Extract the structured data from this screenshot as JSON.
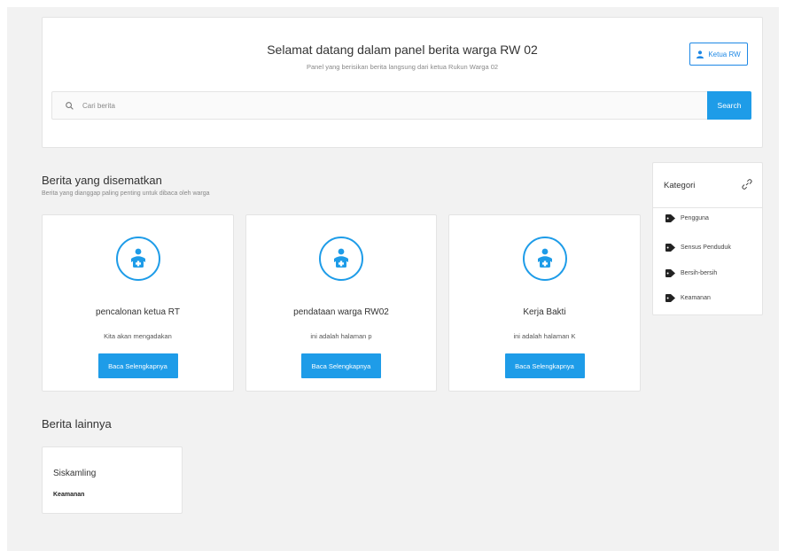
{
  "header": {
    "title": "Selamat datang dalam panel berita warga RW 02",
    "subtitle": "Panel yang berisikan berita langsung dari ketua Rukun Warga 02",
    "user_button": "Ketua RW",
    "search_placeholder": "Cari berita",
    "search_button": "Search"
  },
  "pinned": {
    "title": "Berita yang disematkan",
    "subtitle": "Berita yang dianggap paling penting untuk dibaca oleh warga",
    "items": [
      {
        "title": "pencalonan ketua RT",
        "excerpt": "Kita akan mengadakan",
        "button": "Baca Selengkapnya"
      },
      {
        "title": "pendataan warga RW02",
        "excerpt": "ini adalah halaman p",
        "button": "Baca Selengkapnya"
      },
      {
        "title": "Kerja Bakti",
        "excerpt": "ini adalah halaman K",
        "button": "Baca Selengkapnya"
      }
    ]
  },
  "kategori": {
    "title": "Kategori",
    "items": [
      "Pengguna",
      "Sensus Penduduk",
      "Bersih-bersih",
      "Keamanan"
    ]
  },
  "other": {
    "title": "Berita lainnya",
    "items": [
      {
        "title": "Siskamling",
        "category": "Keamanan"
      }
    ]
  },
  "colors": {
    "accent": "#1e9ce8",
    "background": "#f2f2f2"
  }
}
